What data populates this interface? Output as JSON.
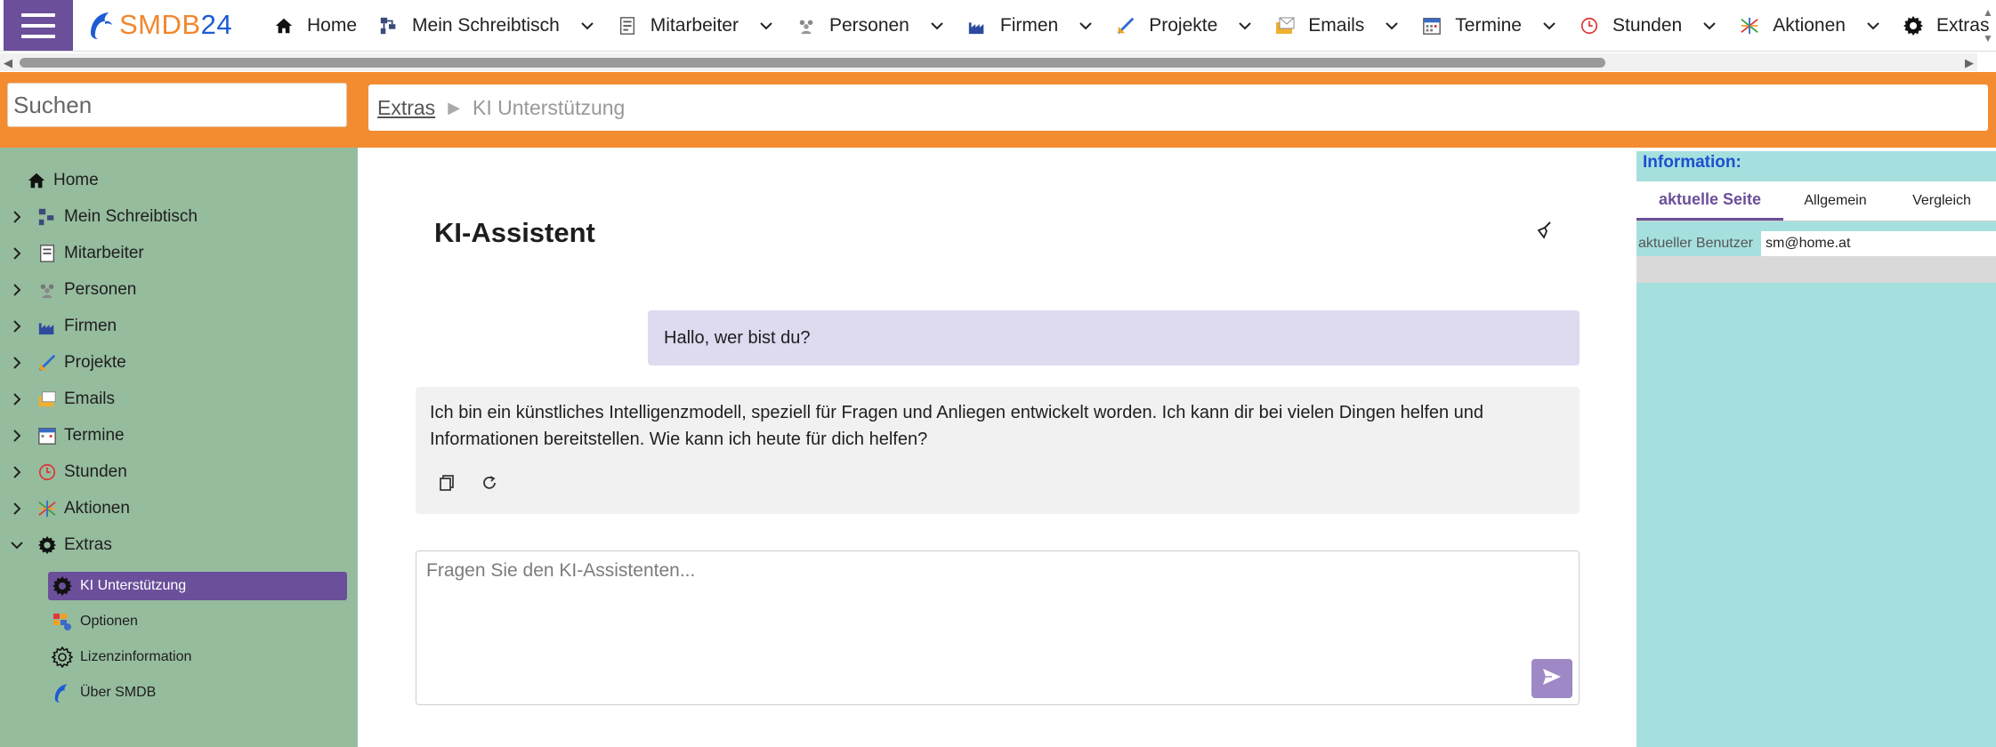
{
  "topnav": {
    "brand_main": "SMDB",
    "brand_num": "24",
    "items": [
      {
        "label": "Home",
        "icon": "home-icon"
      },
      {
        "label": "Mein Schreibtisch",
        "icon": "desk-icon"
      },
      {
        "label": "Mitarbeiter",
        "icon": "employee-icon"
      },
      {
        "label": "Personen",
        "icon": "people-icon"
      },
      {
        "label": "Firmen",
        "icon": "factory-icon"
      },
      {
        "label": "Projekte",
        "icon": "project-icon"
      },
      {
        "label": "Emails",
        "icon": "email-icon"
      },
      {
        "label": "Termine",
        "icon": "calendar-icon"
      },
      {
        "label": "Stunden",
        "icon": "clock-icon"
      },
      {
        "label": "Aktionen",
        "icon": "actions-icon"
      },
      {
        "label": "Extras",
        "icon": "gear-icon"
      }
    ]
  },
  "search": {
    "placeholder": "Suchen"
  },
  "breadcrumb": {
    "parent": "Extras",
    "current": "KI Unterstützung"
  },
  "sidebar": {
    "items": [
      {
        "label": "Home",
        "icon": "home-icon"
      },
      {
        "label": "Mein Schreibtisch",
        "icon": "desk-icon"
      },
      {
        "label": "Mitarbeiter",
        "icon": "employee-icon"
      },
      {
        "label": "Personen",
        "icon": "people-icon"
      },
      {
        "label": "Firmen",
        "icon": "factory-icon"
      },
      {
        "label": "Projekte",
        "icon": "project-icon"
      },
      {
        "label": "Emails",
        "icon": "email-icon"
      },
      {
        "label": "Termine",
        "icon": "calendar-icon"
      },
      {
        "label": "Stunden",
        "icon": "clock-icon"
      },
      {
        "label": "Aktionen",
        "icon": "actions-icon"
      },
      {
        "label": "Extras",
        "icon": "gear-icon"
      }
    ],
    "sub_items": [
      {
        "label": "KI Unterstützung",
        "icon": "gear-icon",
        "active": true
      },
      {
        "label": "Optionen",
        "icon": "options-icon"
      },
      {
        "label": "Lizenzinformation",
        "icon": "gear-outline-icon"
      },
      {
        "label": "Über SMDB",
        "icon": "dolphin-icon"
      }
    ]
  },
  "main": {
    "title": "KI-Assistent",
    "user_message": "Hallo, wer bist du?",
    "bot_message": "Ich bin ein künstliches Intelligenzmodell, speziell für Fragen und Anliegen entwickelt worden. Ich kann dir bei vielen Dingen helfen und Informationen bereitstellen. Wie kann ich heute für dich helfen?",
    "input_placeholder": "Fragen Sie den KI-Assistenten..."
  },
  "info": {
    "title": "Information:",
    "tabs": [
      "aktuelle Seite",
      "Allgemein",
      "Vergleich"
    ],
    "row_label": "aktueller Benutzer",
    "row_value": "sm@home.at"
  },
  "colors": {
    "accent_purple": "#6b4f9a",
    "orange": "#f38b31",
    "sidebar_green": "#96bc9e",
    "info_cyan": "#a6e0de"
  }
}
